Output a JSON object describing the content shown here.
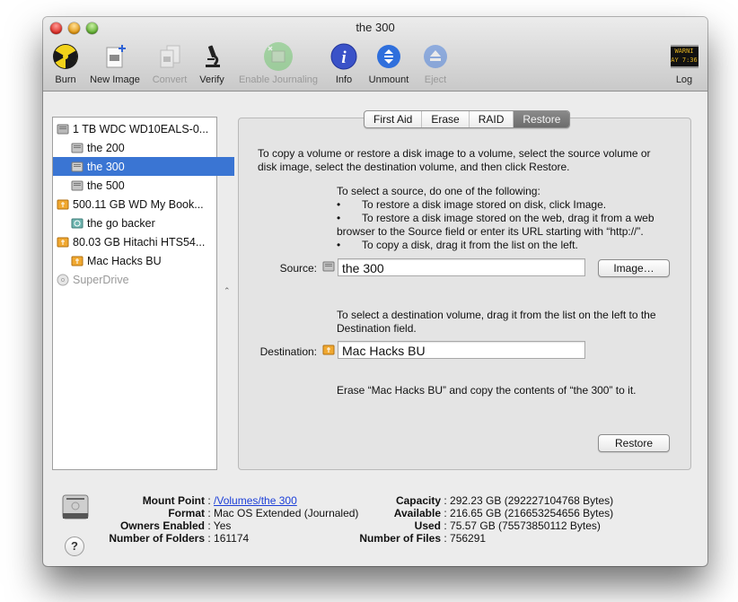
{
  "window": {
    "title": "the 300"
  },
  "toolbar": {
    "items": [
      {
        "label": "Burn",
        "icon": "burn-icon",
        "enabled": true
      },
      {
        "label": "New Image",
        "icon": "new-image-icon",
        "enabled": true
      },
      {
        "label": "Convert",
        "icon": "convert-icon",
        "enabled": false
      },
      {
        "label": "Verify",
        "icon": "microscope-icon",
        "enabled": true
      },
      {
        "label": "Enable Journaling",
        "icon": "journaling-icon",
        "enabled": false
      },
      {
        "label": "Info",
        "icon": "info-icon",
        "enabled": true
      },
      {
        "label": "Unmount",
        "icon": "unmount-icon",
        "enabled": true
      },
      {
        "label": "Eject",
        "icon": "eject-icon",
        "enabled": false
      }
    ],
    "log": {
      "label": "Log",
      "icon": "log-icon",
      "screen_line1": "WARNI",
      "screen_line2": "AY 7:36"
    }
  },
  "sidebar": {
    "items": [
      {
        "label": "1 TB WDC WD10EALS-0...",
        "icon": "internal-disk-icon",
        "level": 0
      },
      {
        "label": "the 200",
        "icon": "volume-icon",
        "level": 1
      },
      {
        "label": "the 300",
        "icon": "volume-icon",
        "level": 1,
        "selected": true
      },
      {
        "label": "the 500",
        "icon": "volume-icon",
        "level": 1
      },
      {
        "label": "500.11 GB WD My Book...",
        "icon": "external-disk-icon",
        "level": 0
      },
      {
        "label": "the go backer",
        "icon": "time-machine-volume-icon",
        "level": 1
      },
      {
        "label": "80.03 GB Hitachi HTS54...",
        "icon": "external-disk-icon",
        "level": 0
      },
      {
        "label": "Mac Hacks BU",
        "icon": "external-volume-icon",
        "level": 1
      },
      {
        "label": "SuperDrive",
        "icon": "optical-drive-icon",
        "level": 0,
        "dimmed": true
      }
    ]
  },
  "tabs": [
    {
      "label": "First Aid"
    },
    {
      "label": "Erase"
    },
    {
      "label": "RAID"
    },
    {
      "label": "Restore",
      "active": true
    }
  ],
  "restore": {
    "intro": "To copy a volume or restore a disk image to a volume, select the source volume or disk image, select the destination volume, and then click Restore.",
    "source_help_title": "To select a source, do one of the following:",
    "source_help_bullets": [
      "To restore a disk image stored on disk, click Image.",
      "To restore a disk image stored on the web, drag it from a web",
      "To copy a disk, drag it from the list on the left."
    ],
    "source_help_cont": "browser to the Source field or enter its URL starting with “http://”.",
    "bullet_char": "•",
    "source_label": "Source:",
    "source_value": "the 300",
    "image_button": "Image…",
    "dest_help": "To select a destination volume, drag it from the list on the left to the Destination field.",
    "dest_label": "Destination:",
    "dest_value": "Mac Hacks BU",
    "summary": "Erase “Mac Hacks BU” and copy the contents of “the 300” to it.",
    "restore_button": "Restore"
  },
  "info": {
    "left": [
      {
        "key": "Mount Point",
        "value": "/Volumes/the 300",
        "link": true
      },
      {
        "key": "Format",
        "value": "Mac OS Extended (Journaled)"
      },
      {
        "key": "Owners Enabled",
        "value": "Yes"
      },
      {
        "key": "Number of Folders",
        "value": "161174"
      }
    ],
    "right": [
      {
        "key": "Capacity",
        "value": "292.23 GB (292227104768 Bytes)"
      },
      {
        "key": "Available",
        "value": "216.65 GB (216653254656 Bytes)"
      },
      {
        "key": "Used",
        "value": "75.57 GB (75573850112 Bytes)"
      },
      {
        "key": "Number of Files",
        "value": "756291"
      }
    ],
    "separator": " : ",
    "help_label": "?"
  }
}
